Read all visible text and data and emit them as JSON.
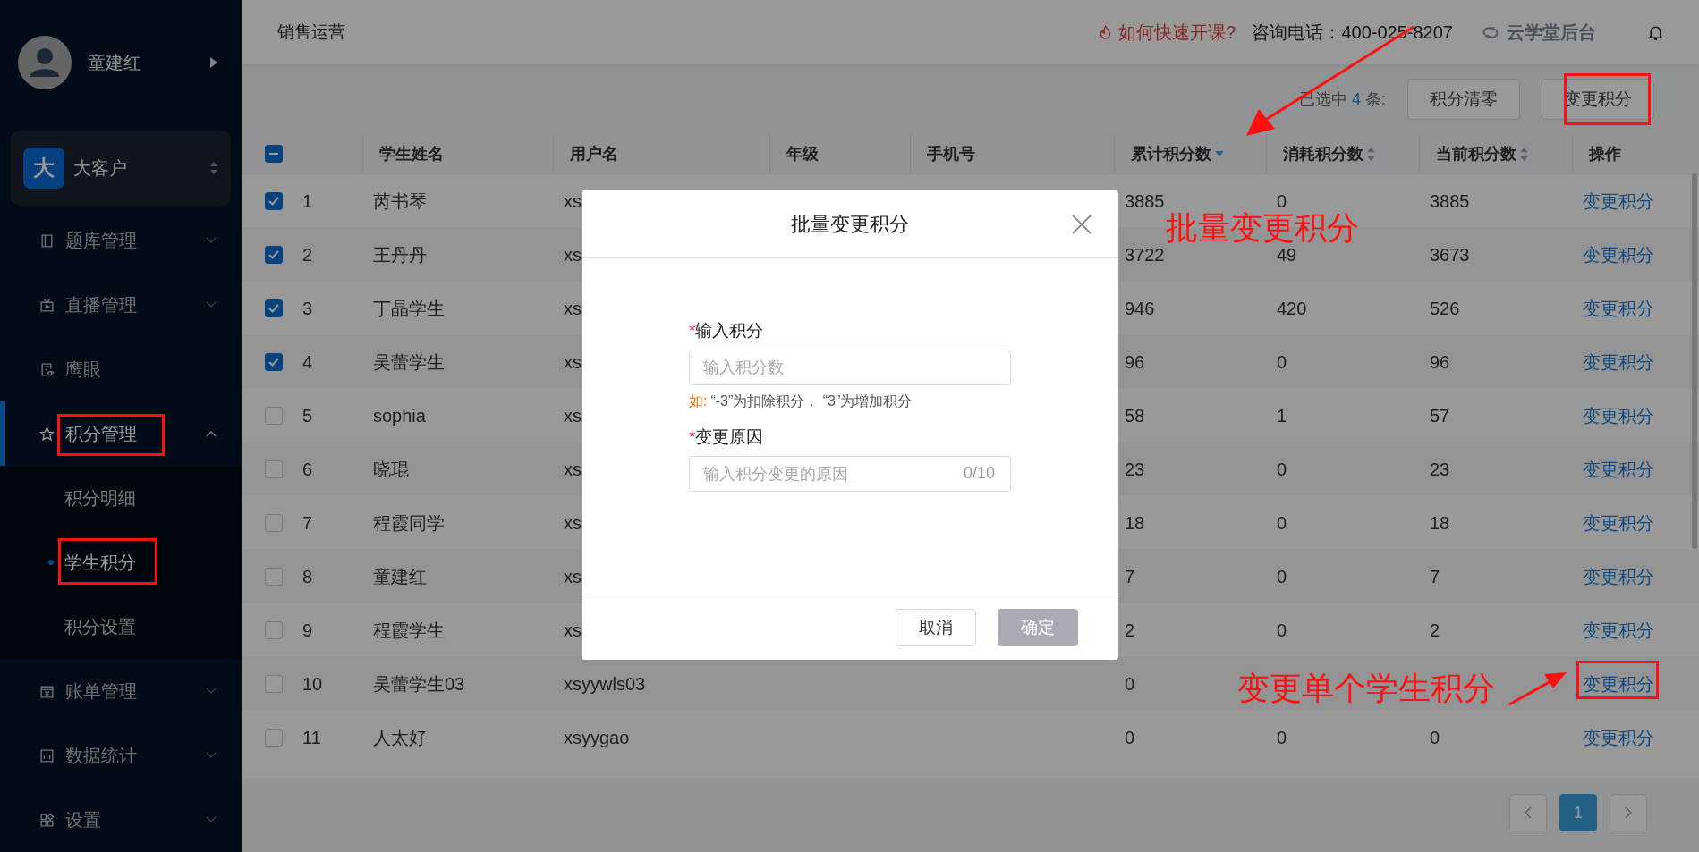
{
  "sidebar": {
    "user": {
      "name": "童建红"
    },
    "org": {
      "badge": "大",
      "name": "大客户"
    },
    "items": [
      {
        "kind": "group",
        "label": "题库管理",
        "expanded": false,
        "selected": false
      },
      {
        "kind": "group",
        "label": "直播管理",
        "expanded": false,
        "selected": false
      },
      {
        "kind": "link",
        "label": "鹰眼",
        "selected": false
      },
      {
        "kind": "group",
        "label": "积分管理",
        "expanded": true,
        "selected": true,
        "children": [
          {
            "label": "积分明细",
            "selected": false
          },
          {
            "label": "学生积分",
            "selected": true
          },
          {
            "label": "积分设置",
            "selected": false
          }
        ]
      },
      {
        "kind": "group",
        "label": "账单管理",
        "expanded": false,
        "selected": false
      },
      {
        "kind": "group",
        "label": "数据统计",
        "expanded": false,
        "selected": false
      },
      {
        "kind": "group",
        "label": "设置",
        "expanded": false,
        "selected": false
      }
    ]
  },
  "header": {
    "title": "销售运营",
    "help_link": "如何快速开课?",
    "phone": "咨询电话：400-025-8207",
    "brand": "云学堂后台"
  },
  "toolbar": {
    "selected_prefix": "已选中",
    "selected_count": "4",
    "selected_suffix": "条:",
    "buttons": [
      "积分清零",
      "变更积分"
    ]
  },
  "table": {
    "select_all_checked": true,
    "select_all_partial": true,
    "columns": [
      {
        "label": "学生姓名",
        "sortable": false
      },
      {
        "label": "用户名",
        "sortable": false
      },
      {
        "label": "年级",
        "sortable": false
      },
      {
        "label": "手机号",
        "sortable": false
      },
      {
        "label": "累计积分数",
        "sortable": true,
        "sorted": true
      },
      {
        "label": "消耗积分数",
        "sortable": true,
        "sorted": false
      },
      {
        "label": "当前积分数",
        "sortable": true,
        "sorted": false
      },
      {
        "label": "操作",
        "sortable": false
      }
    ],
    "rows": [
      {
        "checked": true,
        "index": "1",
        "name": "芮书琴",
        "username": "xs",
        "total": "3885",
        "consumed": "0",
        "current": "3885",
        "action": "变更积分"
      },
      {
        "checked": true,
        "index": "2",
        "name": "王丹丹",
        "username": "xs",
        "total": "3722",
        "consumed": "49",
        "current": "3673",
        "action": "变更积分"
      },
      {
        "checked": true,
        "index": "3",
        "name": "丁晶学生",
        "username": "xs",
        "total": "946",
        "consumed": "420",
        "current": "526",
        "action": "变更积分"
      },
      {
        "checked": true,
        "index": "4",
        "name": "吴蕾学生",
        "username": "xs",
        "total": "96",
        "consumed": "0",
        "current": "96",
        "action": "变更积分"
      },
      {
        "checked": false,
        "index": "5",
        "name": "sophia",
        "username": "xs",
        "total": "58",
        "consumed": "1",
        "current": "57",
        "action": "变更积分"
      },
      {
        "checked": false,
        "index": "6",
        "name": "晓琨",
        "username": "xs",
        "total": "23",
        "consumed": "0",
        "current": "23",
        "action": "变更积分"
      },
      {
        "checked": false,
        "index": "7",
        "name": "程霞同学",
        "username": "xs",
        "total": "18",
        "consumed": "0",
        "current": "18",
        "action": "变更积分"
      },
      {
        "checked": false,
        "index": "8",
        "name": "童建红",
        "username": "xs",
        "total": "7",
        "consumed": "0",
        "current": "7",
        "action": "变更积分"
      },
      {
        "checked": false,
        "index": "9",
        "name": "程霞学生",
        "username": "xs",
        "total": "2",
        "consumed": "0",
        "current": "2",
        "action": "变更积分"
      },
      {
        "checked": false,
        "index": "10",
        "name": "吴蕾学生03",
        "username": "xsyywls03",
        "total": "0",
        "action": "变更积分"
      },
      {
        "checked": false,
        "index": "11",
        "name": "人太好",
        "username": "xsyygao",
        "total": "0",
        "consumed": "0",
        "current": "0",
        "action": "变更积分"
      }
    ]
  },
  "pagination": {
    "pages": [
      {
        "label": "1",
        "selected": true
      }
    ]
  },
  "modal": {
    "title": "批量变更积分",
    "fields": [
      {
        "label": "输入积分",
        "required_mark": "*",
        "placeholder": "输入积分数",
        "hint_prefix": "如:",
        "hint": "“-3”为扣除积分， “3”为增加积分"
      },
      {
        "label": "变更原因",
        "required_mark": "*",
        "placeholder": "输入积分变更的原因",
        "counter": "0/10"
      }
    ],
    "cancel": "取消",
    "confirm": {
      "label": "确定",
      "disabled": true
    }
  },
  "annotations": [
    "批量变更积分",
    "变更单个学生积分"
  ]
}
